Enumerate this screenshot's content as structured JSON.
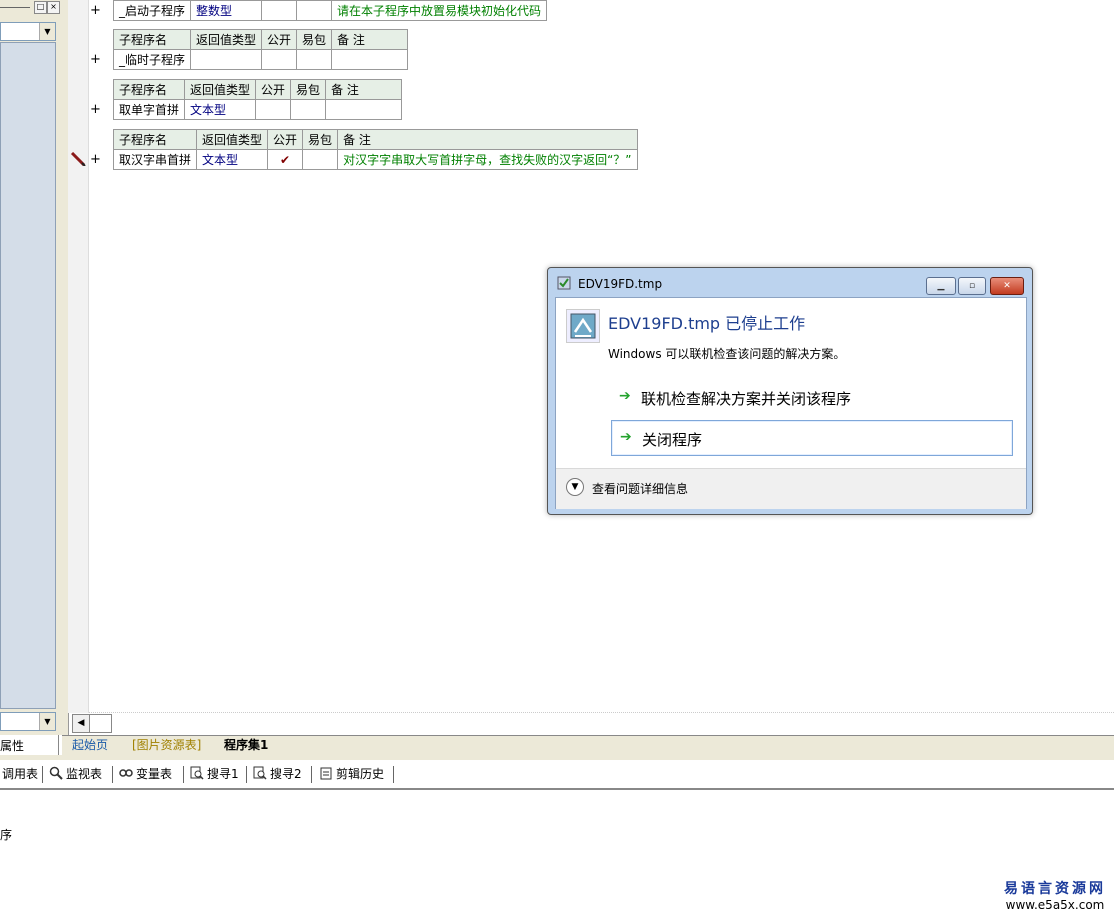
{
  "left_panel": {
    "bottom_tab_label": "属性"
  },
  "subroutines": [
    {
      "header": [
        "子程序名",
        "返回值类型",
        "公开",
        "易包",
        "备 注"
      ],
      "name": "_启动子程序",
      "return_type": "整数型",
      "public": "",
      "easy_pkg": "",
      "note": "请在本子程序中放置易模块初始化代码"
    },
    {
      "header": [
        "子程序名",
        "返回值类型",
        "公开",
        "易包",
        "备 注"
      ],
      "name": "_临时子程序",
      "return_type": "",
      "public": "",
      "easy_pkg": "",
      "note": ""
    },
    {
      "header": [
        "子程序名",
        "返回值类型",
        "公开",
        "易包",
        "备 注"
      ],
      "name": "取单字首拼",
      "return_type": "文本型",
      "public": "",
      "easy_pkg": "",
      "note": ""
    },
    {
      "header": [
        "子程序名",
        "返回值类型",
        "公开",
        "易包",
        "备 注"
      ],
      "name": "取汉字串首拼",
      "return_type": "文本型",
      "public": "✔",
      "easy_pkg": "",
      "note": "对汉字字串取大写首拼字母，查找失败的汉字返回“？”"
    }
  ],
  "expand_symbol": "+",
  "doc_tabs": [
    {
      "label": "起始页",
      "color": "#1a5aa8"
    },
    {
      "label": "[图片资源表]",
      "color": "#a08000"
    },
    {
      "label": "程序集1",
      "color": "#000000"
    }
  ],
  "bottom_tabs": [
    {
      "label": "调用表",
      "icon": "call-table-icon"
    },
    {
      "label": "监视表",
      "icon": "magnifier-icon"
    },
    {
      "label": "变量表",
      "icon": "variables-icon"
    },
    {
      "label": "搜寻1",
      "icon": "search-doc-icon"
    },
    {
      "label": "搜寻2",
      "icon": "search-doc-icon"
    },
    {
      "label": "剪辑历史",
      "icon": "clipboard-icon"
    }
  ],
  "output_text": "序",
  "watermark": {
    "line1": "易语言资源网",
    "line2": "www.e5a5x.com"
  },
  "dialog": {
    "title": "EDV19FD.tmp",
    "heading": "EDV19FD.tmp 已停止工作",
    "subtitle": "Windows 可以联机检查该问题的解决方案。",
    "option1": "联机检查解决方案并关闭该程序",
    "option2": "关闭程序",
    "details": "查看问题详细信息",
    "colors": {
      "heading": "#1e3f8f",
      "arrow": "#24a32e"
    }
  }
}
